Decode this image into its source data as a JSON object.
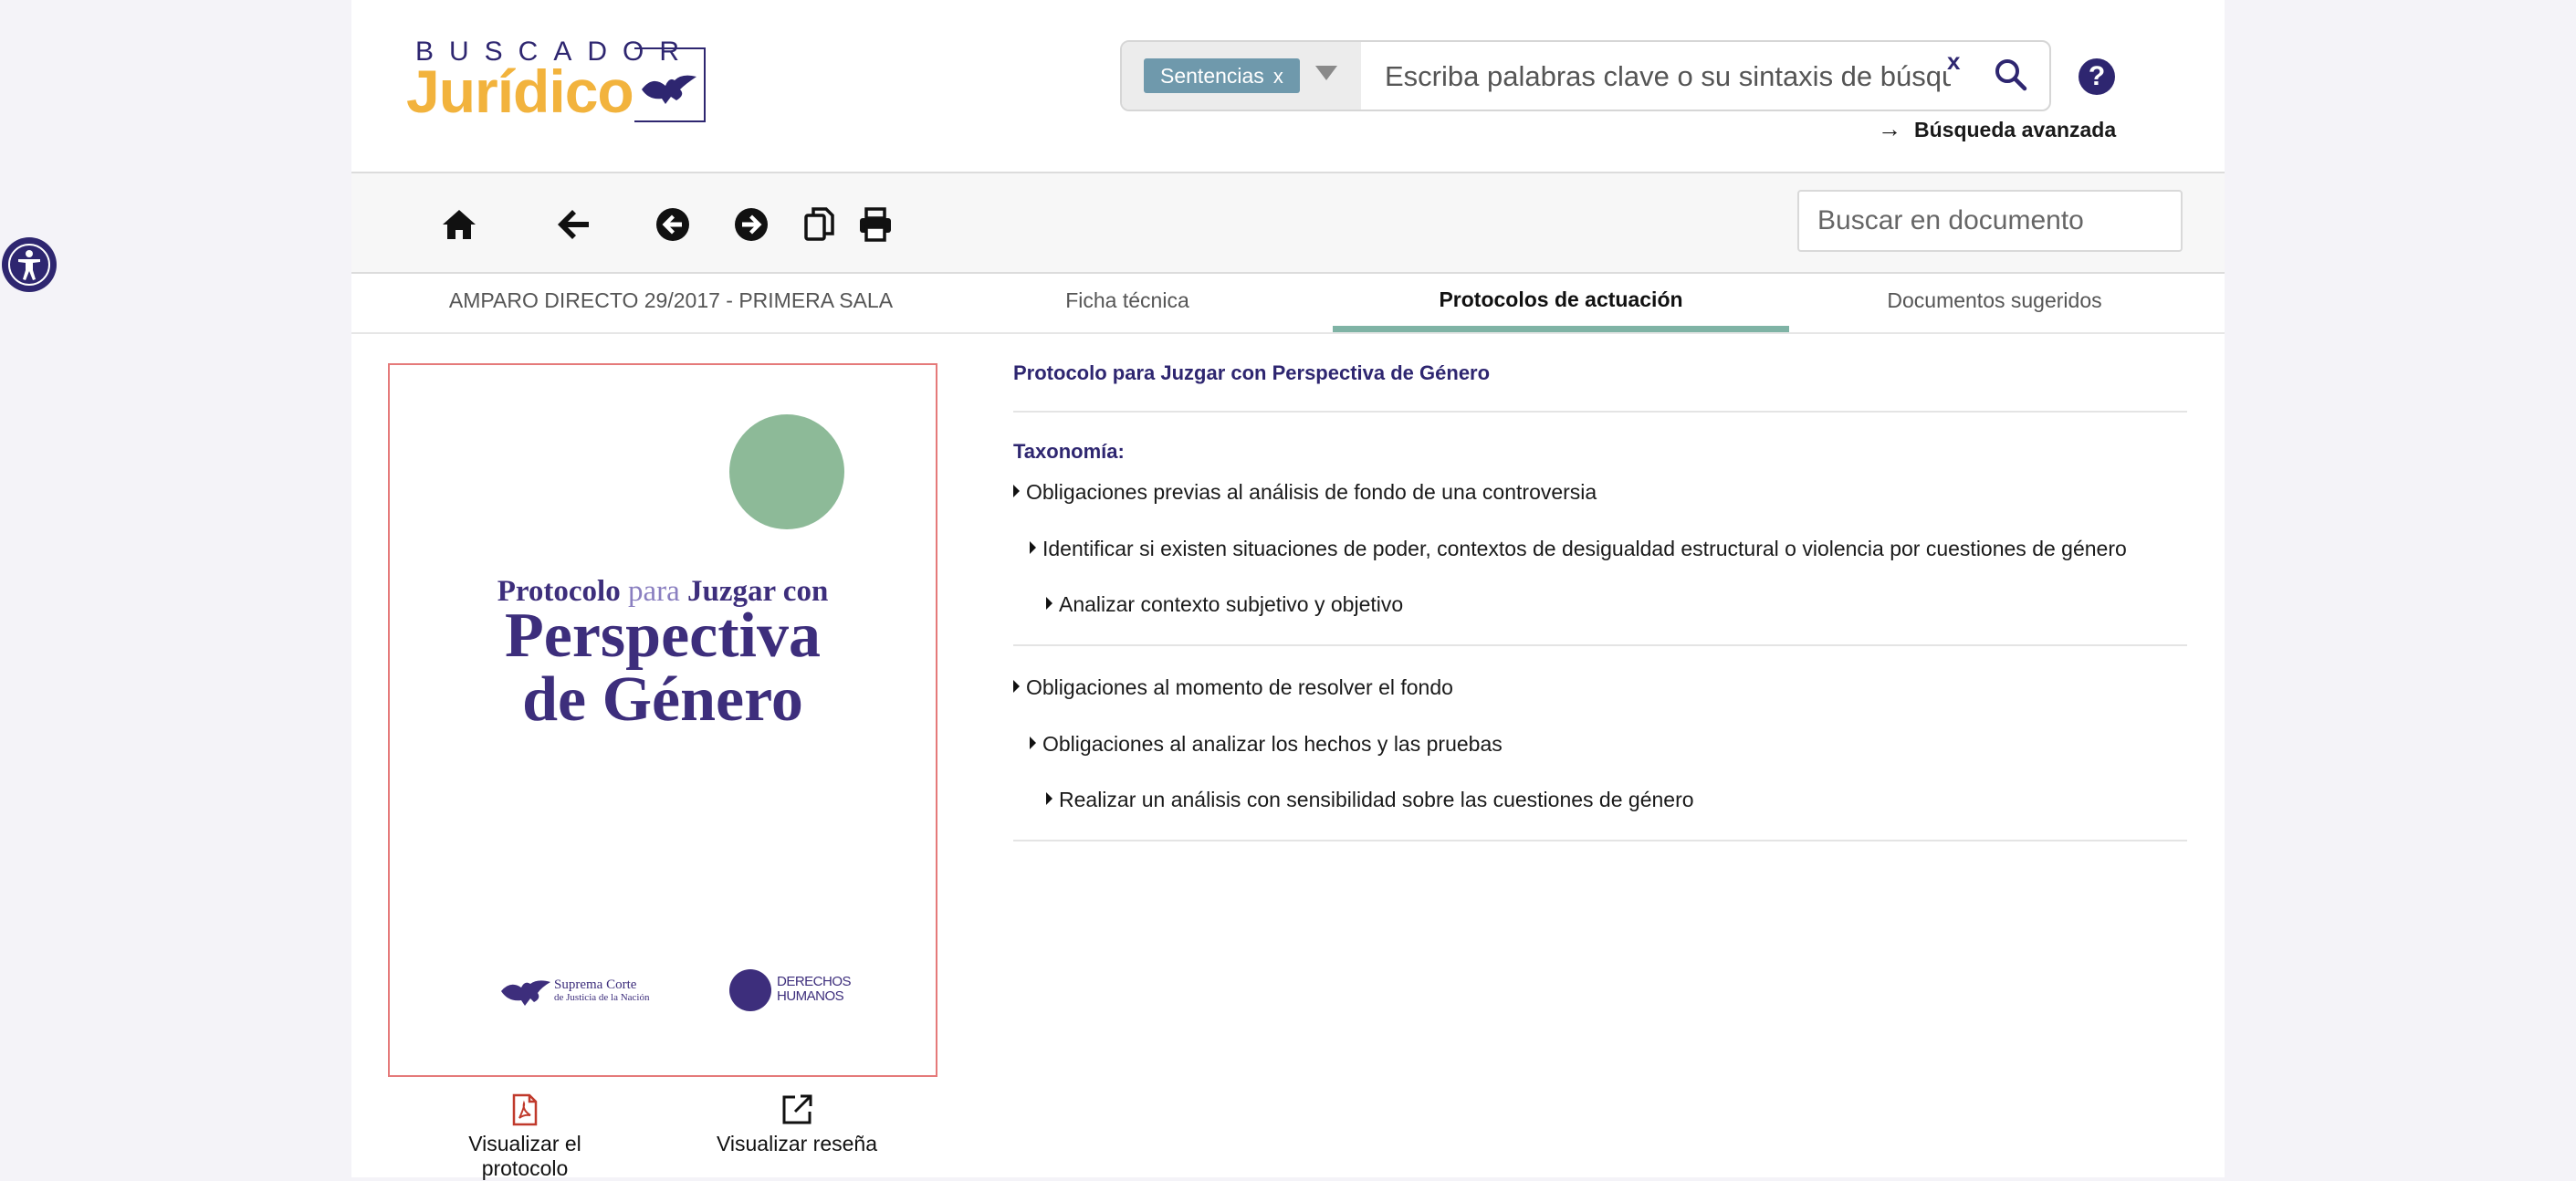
{
  "header": {
    "logo_top": "BUSCADOR",
    "logo_main": "Jurídico",
    "search": {
      "scope_chip": "Sentencias",
      "scope_chip_remove": "x",
      "placeholder": "Escriba palabras clave o su sintaxis de búsqueda",
      "clear": "x"
    },
    "help": "?",
    "advanced_arrow": "→",
    "advanced_label": "Búsqueda avanzada"
  },
  "toolbar": {
    "icons": [
      "home-icon",
      "back-arrow-icon",
      "previous-circle-icon",
      "next-circle-icon",
      "copy-icon",
      "print-icon"
    ],
    "doc_search_placeholder": "Buscar en documento"
  },
  "tabs": [
    {
      "label": "AMPARO DIRECTO 29/2017 - PRIMERA SALA",
      "active": false
    },
    {
      "label": "Ficha técnica",
      "active": false
    },
    {
      "label": "Protocolos de actuación",
      "active": true
    },
    {
      "label": "Documentos sugeridos",
      "active": false
    }
  ],
  "cover": {
    "line1_a": "Protocolo",
    "line1_b": "para",
    "line1_c": "Juzgar con",
    "line2": "Perspectiva",
    "line3": "de Género",
    "scjn_line1": "Suprema Corte",
    "scjn_line2": "de Justicia de la Nación",
    "dh_line1": "DERECHOS",
    "dh_line2": "HUMANOS",
    "accent_color": "#8dba98",
    "title_color": "#3d2e7c"
  },
  "actions": {
    "view_protocol": "Visualizar el protocolo",
    "view_review": "Visualizar reseña"
  },
  "content": {
    "protocol_title": "Protocolo para Juzgar con Perspectiva de Género",
    "taxonomy_label": "Taxonomía:",
    "groups": [
      {
        "level1": "Obligaciones previas al análisis de fondo de una controversia",
        "level2": "Identificar si existen situaciones de poder, contextos de desigualdad estructural o violencia por cuestiones de género",
        "level3": "Analizar contexto subjetivo y objetivo"
      },
      {
        "level1": "Obligaciones al momento de resolver el fondo",
        "level2": "Obligaciones al analizar los hechos y las pruebas",
        "level3": "Realizar un análisis con sensibilidad sobre las cuestiones de género"
      }
    ]
  },
  "colors": {
    "brand_navy": "#2e2670",
    "brand_gold": "#f2b33d",
    "chip_bg": "#6f99ac",
    "active_tab_underline": "#7fb3a5",
    "pdf_red": "#c0392b"
  }
}
